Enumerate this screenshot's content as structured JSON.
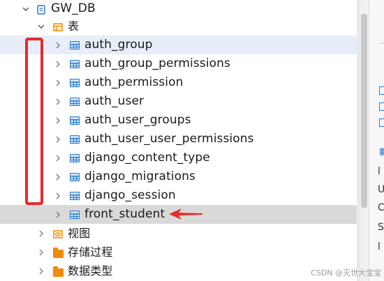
{
  "tree": {
    "database": {
      "label": "GW_DB",
      "icon": "database-icon"
    },
    "tables_folder": {
      "label": "表",
      "icon": "table-folder-icon"
    },
    "tables": [
      {
        "label": "auth_group",
        "state": "hover"
      },
      {
        "label": "auth_group_permissions",
        "state": ""
      },
      {
        "label": "auth_permission",
        "state": ""
      },
      {
        "label": "auth_user",
        "state": ""
      },
      {
        "label": "auth_user_groups",
        "state": ""
      },
      {
        "label": "auth_user_user_permissions",
        "state": ""
      },
      {
        "label": "django_content_type",
        "state": ""
      },
      {
        "label": "django_migrations",
        "state": ""
      },
      {
        "label": "django_session",
        "state": ""
      },
      {
        "label": "front_student",
        "state": "selected"
      }
    ],
    "folders": [
      {
        "label": "视图",
        "icon": "view-icon"
      },
      {
        "label": "存储过程",
        "icon": "folder-icon"
      },
      {
        "label": "数据类型",
        "icon": "folder-icon"
      }
    ]
  },
  "right_panel": {
    "items": [
      "l",
      "U",
      "C",
      "S",
      "l"
    ]
  },
  "colors": {
    "accent": "#2a78c8",
    "folder": "#f28b00",
    "annotation": "#e52b2b",
    "hover": "#e7eef9",
    "selected": "#d9d9d9"
  },
  "watermark": "CSDN @灭世大宝宝"
}
